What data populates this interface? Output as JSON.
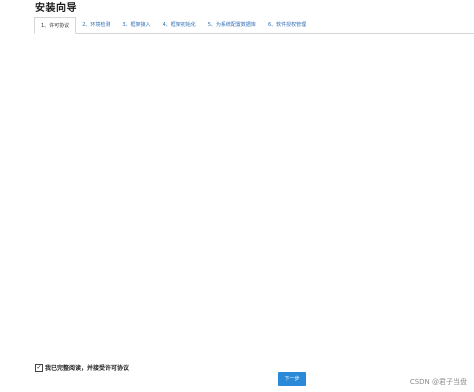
{
  "page_title": "安装向导",
  "tabs": [
    {
      "label": "1、许可协议"
    },
    {
      "label": "2、环境检测"
    },
    {
      "label": "3、框架接入"
    },
    {
      "label": "4、框架初始化"
    },
    {
      "label": "5、为系统配置数据库"
    },
    {
      "label": "6、软件授权管理"
    }
  ],
  "agreement": {
    "checked": true,
    "check_glyph": "✓",
    "label": "我已完整阅读，并接受许可协议"
  },
  "next_button_label": "下一步",
  "watermark": "CSDN @君子当盘",
  "colors": {
    "tab_text": "#2f6db5",
    "button_bg": "#2a8ad8"
  }
}
